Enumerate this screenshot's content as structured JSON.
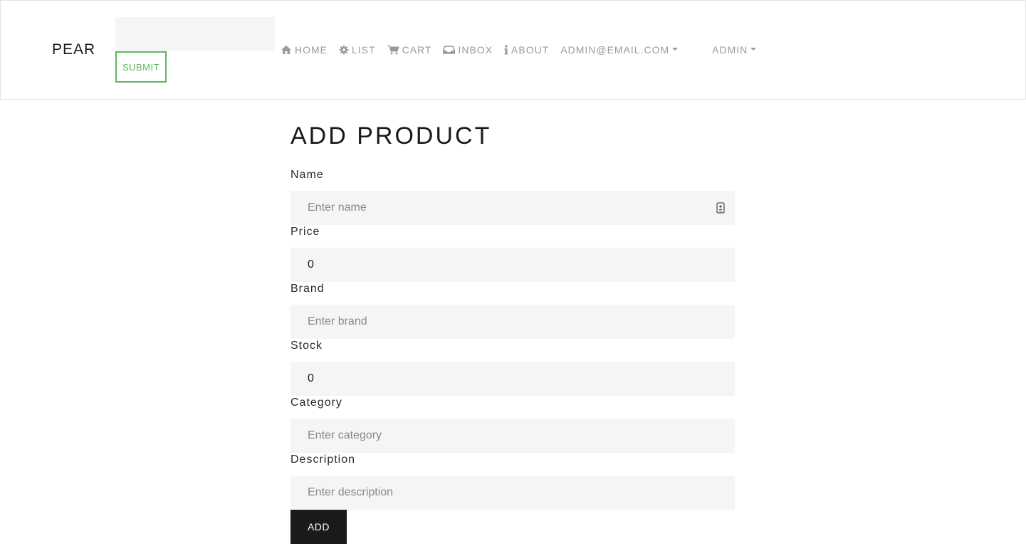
{
  "navbar": {
    "brand": "PEAR",
    "search": {
      "value": "",
      "placeholder": ""
    },
    "submit_label": "SUBMIT",
    "links": {
      "home": {
        "label": "HOME",
        "icon": "home-icon"
      },
      "list": {
        "label": "LIST",
        "icon": "gear-icon"
      },
      "cart": {
        "label": "CART",
        "icon": "cart-icon"
      },
      "inbox": {
        "label": "INBOX",
        "icon": "inbox-icon"
      },
      "about": {
        "label": "ABOUT",
        "icon": "info-icon"
      },
      "account": {
        "label": "ADMIN@EMAIL.COM",
        "icon": "caret-down-icon"
      },
      "admin": {
        "label": "ADMIN",
        "icon": "caret-down-icon"
      }
    }
  },
  "form": {
    "title": "ADD PRODUCT",
    "fields": {
      "name": {
        "label": "Name",
        "placeholder": "Enter name",
        "value": ""
      },
      "price": {
        "label": "Price",
        "placeholder": "",
        "value": "0"
      },
      "brand": {
        "label": "Brand",
        "placeholder": "Enter brand",
        "value": ""
      },
      "stock": {
        "label": "Stock",
        "placeholder": "",
        "value": "0"
      },
      "category": {
        "label": "Category",
        "placeholder": "Enter category",
        "value": ""
      },
      "description": {
        "label": "Description",
        "placeholder": "Enter description",
        "value": ""
      }
    },
    "add_label": "ADD"
  },
  "colors": {
    "accent_green": "#5cb85c",
    "nav_text": "#9a9a9a",
    "input_bg": "#f5f5f6",
    "button_dark": "#1a1a1a"
  }
}
